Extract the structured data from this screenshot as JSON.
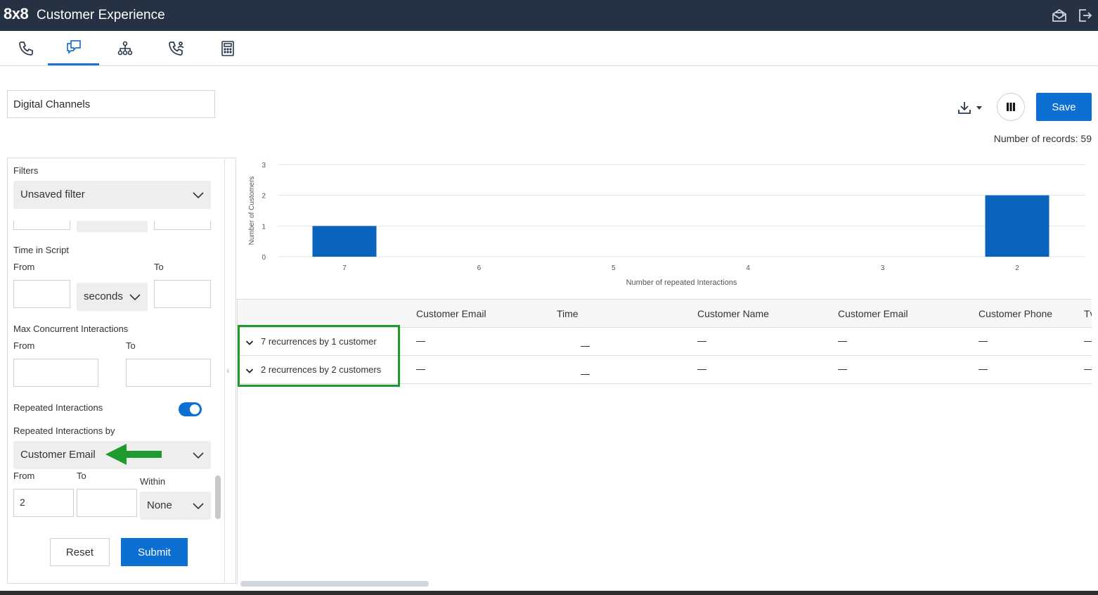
{
  "header": {
    "logo": "8x8",
    "title": "Customer Experience",
    "icons": [
      "mail-open-icon",
      "logout-icon"
    ]
  },
  "tabs": [
    {
      "icon": "phone-icon",
      "active": false
    },
    {
      "icon": "chat-bubbles-icon",
      "active": true
    },
    {
      "icon": "hierarchy-icon",
      "active": false
    },
    {
      "icon": "phone-users-icon",
      "active": false
    },
    {
      "icon": "calculator-icon",
      "active": false
    }
  ],
  "report": {
    "name": "Digital Channels",
    "save_label": "Save",
    "records_label": "Number of records: 59"
  },
  "filters": {
    "label": "Filters",
    "selected_filter": "Unsaved filter",
    "time_in_script": {
      "label": "Time in Script",
      "from_label": "From",
      "to_label": "To",
      "from_value": "",
      "to_value": "",
      "unit": "seconds"
    },
    "max_concurrent": {
      "label": "Max Concurrent Interactions",
      "from_label": "From",
      "to_label": "To",
      "from_value": "",
      "to_value": ""
    },
    "repeated": {
      "label": "Repeated Interactions",
      "enabled": true,
      "by_label": "Repeated Interactions by",
      "by_value": "Customer Email",
      "from_label": "From",
      "to_label": "To",
      "within_label": "Within",
      "from_value": "2",
      "to_value": "",
      "within_value": "None"
    },
    "reset_label": "Reset",
    "submit_label": "Submit"
  },
  "chart_data": {
    "type": "bar",
    "categories": [
      "7",
      "6",
      "5",
      "4",
      "3",
      "2"
    ],
    "values": [
      1,
      0,
      0,
      0,
      0,
      2
    ],
    "xlabel": "Number of repeated Interactions",
    "ylabel": "Number of Customers",
    "ylim": [
      0,
      3
    ],
    "yticks": [
      "0",
      "1",
      "2",
      "3"
    ],
    "bar_color": "#0a64bd",
    "grid": true
  },
  "grid": {
    "columns": [
      "Customer Email",
      "Time",
      "Customer Name",
      "Customer Email",
      "Customer Phone",
      "Tv"
    ],
    "rows": [
      {
        "group": "7 recurrences by 1 customer"
      },
      {
        "group": "2 recurrences by 2 customers"
      }
    ]
  },
  "colors": {
    "topbar": "#263244",
    "accent": "#0d6fd1",
    "highlight": "#1f9a2e"
  }
}
